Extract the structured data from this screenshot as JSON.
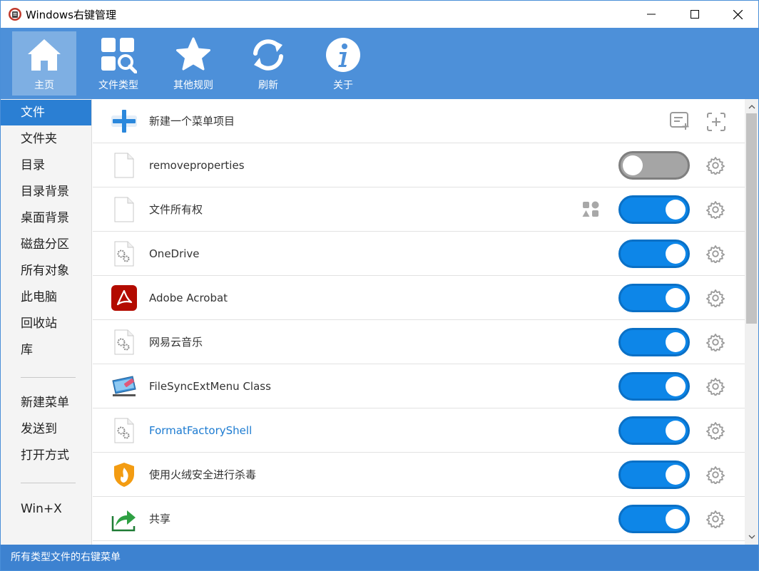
{
  "window": {
    "title": "Windows右键管理",
    "controls": {
      "minimize": "minimize",
      "maximize": "maximize",
      "close": "close"
    }
  },
  "toolbar": {
    "items": [
      {
        "label": "主页",
        "icon": "home-icon",
        "active": true
      },
      {
        "label": "文件类型",
        "icon": "file-type-search-icon",
        "active": false
      },
      {
        "label": "其他规则",
        "icon": "star-icon",
        "active": false
      },
      {
        "label": "刷新",
        "icon": "refresh-icon",
        "active": false
      },
      {
        "label": "关于",
        "icon": "info-icon",
        "active": false
      }
    ]
  },
  "sidebar": {
    "items": [
      {
        "label": "文件",
        "active": true
      },
      {
        "label": "文件夹"
      },
      {
        "label": "目录"
      },
      {
        "label": "目录背景"
      },
      {
        "label": "桌面背景"
      },
      {
        "label": "磁盘分区"
      },
      {
        "label": "所有对象"
      },
      {
        "label": "此电脑"
      },
      {
        "label": "回收站"
      },
      {
        "label": "库"
      }
    ],
    "group2": [
      {
        "label": "新建菜单"
      },
      {
        "label": "发送到"
      },
      {
        "label": "打开方式"
      }
    ],
    "group3": [
      {
        "label": "Win+X"
      }
    ]
  },
  "list": {
    "new_item": {
      "label": "新建一个菜单项目"
    },
    "rows": [
      {
        "label": "removeproperties",
        "enabled": false,
        "icon": "blank-file-icon"
      },
      {
        "label": "文件所有权",
        "enabled": true,
        "icon": "blank-file-icon",
        "extra": "shapes-icon"
      },
      {
        "label": "OneDrive",
        "enabled": true,
        "icon": "gear-file-icon"
      },
      {
        "label": "Adobe Acrobat",
        "enabled": true,
        "icon": "adobe-acrobat-icon"
      },
      {
        "label": "网易云音乐",
        "enabled": true,
        "icon": "gear-file-icon"
      },
      {
        "label": "FileSyncExtMenu Class",
        "enabled": true,
        "icon": "filesync-icon"
      },
      {
        "label": "FormatFactoryShell",
        "enabled": true,
        "icon": "gear-file-icon",
        "link": true
      },
      {
        "label": "使用火绒安全进行杀毒",
        "enabled": true,
        "icon": "huorong-shield-icon"
      },
      {
        "label": "共享",
        "enabled": true,
        "icon": "share-arrow-icon"
      }
    ]
  },
  "statusbar": {
    "text": "所有类型文件的右键菜单"
  },
  "colors": {
    "toolbar": "#4d90d9",
    "accent": "#2b7fd3",
    "toggle_on": "#0d86e8",
    "toggle_off": "#a5a5a5",
    "statusbar": "#3d82d0",
    "link": "#1c7bd1"
  }
}
